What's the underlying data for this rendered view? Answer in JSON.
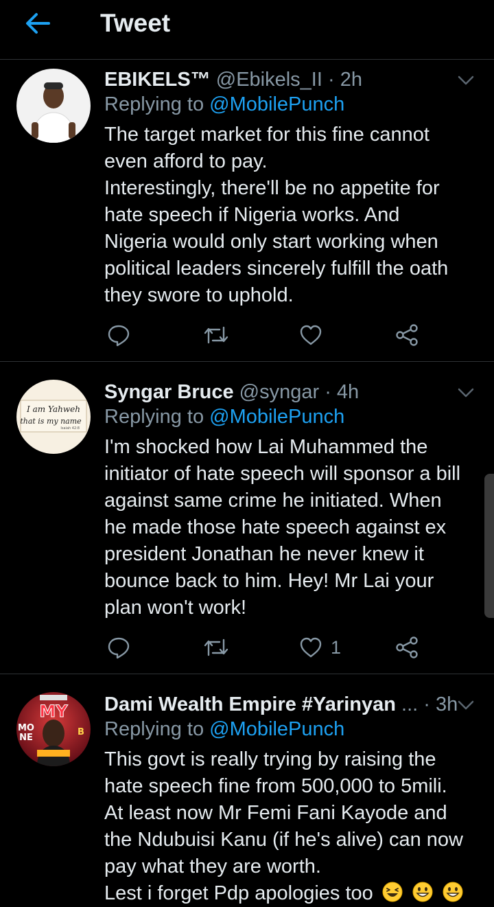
{
  "header": {
    "title": "Tweet",
    "back_icon": "arrow-left-icon",
    "accent_color": "#1da1f2"
  },
  "tweets": [
    {
      "name": "EBIKELS™",
      "handle": "@Ebikels_II",
      "time": "2h",
      "replying_prefix": "Replying to",
      "replying_to": "@MobilePunch",
      "lines": [
        "The target market for this fine cannot",
        "even afford to pay.",
        "Interestingly, there'll be no appetite for",
        "hate speech if Nigeria works. And",
        "Nigeria would only start working when",
        "political leaders sincerely fulfill the oath",
        "they swore to uphold."
      ],
      "like_count": ""
    },
    {
      "name": "Syngar Bruce",
      "handle": "@syngar",
      "time": "4h",
      "replying_prefix": "Replying to",
      "replying_to": "@MobilePunch",
      "avatar_text": [
        "I am Yahweh",
        "that is my name",
        "Isaiah 42:8"
      ],
      "lines": [
        "I'm shocked how Lai Muhammed the",
        "initiator of hate speech will sponsor a bill",
        "against same crime he initiated. When",
        "he made those hate speech against ex",
        "president Jonathan he never knew it",
        "bounce back to him. Hey! Mr Lai your",
        "plan won't work!"
      ],
      "like_count": "1"
    },
    {
      "name": "Dami Wealth Empire #Yarinyan",
      "handle": "...",
      "time": "3h",
      "replying_prefix": "Replying to",
      "replying_to": "@MobilePunch",
      "lines": [
        "This govt is really trying by raising the",
        "hate speech fine from 500,000 to 5mili.",
        "At least now Mr Femi Fani Kayode and",
        "the Ndubuisi Kanu (if he's alive) can now",
        "pay what they are worth.",
        "Lest i forget Pdp apologies too"
      ],
      "like_count": ""
    }
  ]
}
